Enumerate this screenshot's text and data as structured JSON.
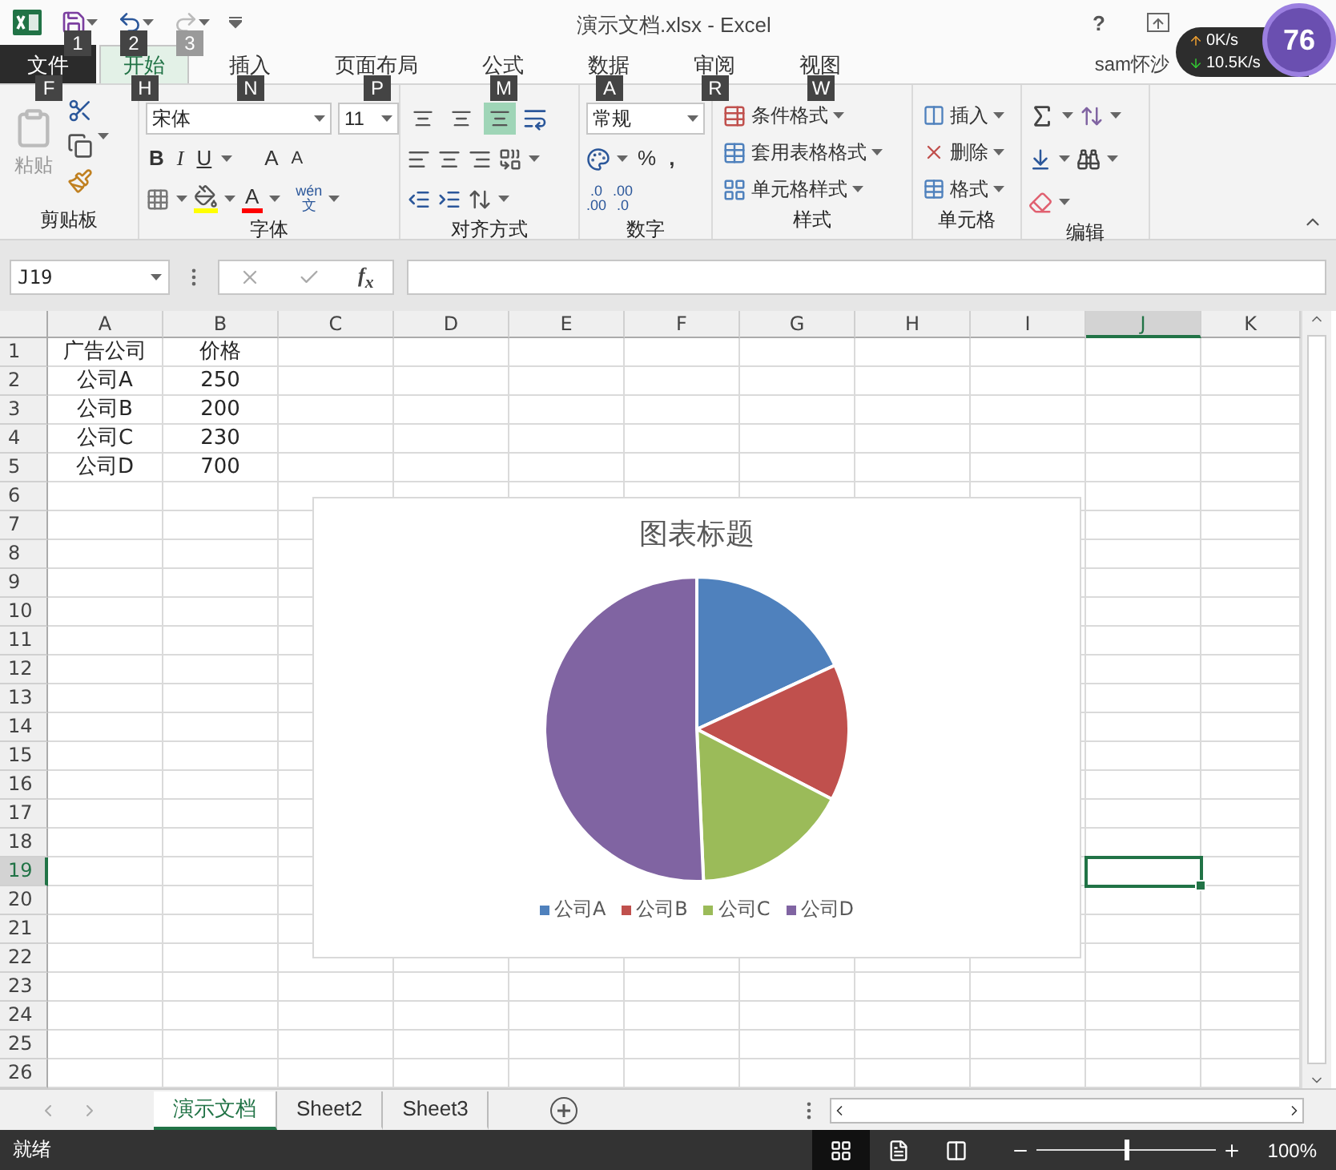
{
  "title_bar": {
    "quick_access": [
      {
        "key_tip": "1",
        "disabled": false
      },
      {
        "key_tip": "2",
        "disabled": false
      },
      {
        "key_tip": "3",
        "disabled": true
      }
    ],
    "title": "演示文档.xlsx - Excel",
    "help": "?",
    "user": "sam怀沙"
  },
  "net_widget": {
    "up": "0K/s",
    "down": "10.5K/s",
    "score": "76"
  },
  "tabs": [
    {
      "label": "文件",
      "key_tip": "F",
      "kind": "file",
      "selected": false
    },
    {
      "label": "开始",
      "key_tip": "H",
      "kind": "tab",
      "selected": true
    },
    {
      "label": "插入",
      "key_tip": "N",
      "kind": "tab",
      "selected": false
    },
    {
      "label": "页面布局",
      "key_tip": "P",
      "kind": "tab",
      "selected": false
    },
    {
      "label": "公式",
      "key_tip": "M",
      "kind": "tab",
      "selected": false
    },
    {
      "label": "数据",
      "key_tip": "A",
      "kind": "tab",
      "selected": false
    },
    {
      "label": "审阅",
      "key_tip": "R",
      "kind": "tab",
      "selected": false
    },
    {
      "label": "视图",
      "key_tip": "W",
      "kind": "tab",
      "selected": false
    }
  ],
  "ribbon": {
    "clipboard": {
      "label": "剪贴板",
      "paste": "粘贴"
    },
    "font": {
      "label": "字体",
      "font_name": "宋体",
      "font_size": "11",
      "bold": "B",
      "italic": "I",
      "underline": "U",
      "grow": "A",
      "shrink": "A",
      "font_color": "A",
      "phonetic_top": "wén",
      "phonetic_bottom": "文"
    },
    "alignment": {
      "label": "对齐方式",
      "vertical": [
        {
          "selected": false
        },
        {
          "selected": false
        },
        {
          "selected": true
        }
      ]
    },
    "number": {
      "label": "数字",
      "format": "常规",
      "percent": "%",
      "comma": ",",
      "increase_decimal": [
        ".0",
        ".00"
      ],
      "decrease_decimal": [
        ".00",
        ".0"
      ]
    },
    "styles": {
      "label": "样式",
      "buttons": [
        "条件格式",
        "套用表格格式",
        "单元格样式"
      ]
    },
    "cells": {
      "label": "单元格",
      "buttons": [
        "插入",
        "删除",
        "格式"
      ]
    },
    "editing": {
      "label": "编辑"
    }
  },
  "name_box": {
    "value": "J19"
  },
  "formula_bar": {
    "fx": "f$_{x}$"
  },
  "columns": [
    {
      "label": "A",
      "selected": false
    },
    {
      "label": "B",
      "selected": false
    },
    {
      "label": "C",
      "selected": false
    },
    {
      "label": "D",
      "selected": false
    },
    {
      "label": "E",
      "selected": false
    },
    {
      "label": "F",
      "selected": false
    },
    {
      "label": "G",
      "selected": false
    },
    {
      "label": "H",
      "selected": false
    },
    {
      "label": "I",
      "selected": false
    },
    {
      "label": "J",
      "selected": true
    },
    {
      "label": "K",
      "selected": false
    }
  ],
  "rows": [
    {
      "label": "1",
      "selected": false,
      "cells": [
        "广告公司",
        "价格"
      ]
    },
    {
      "label": "2",
      "selected": false,
      "cells": [
        "公司A",
        "250"
      ]
    },
    {
      "label": "3",
      "selected": false,
      "cells": [
        "公司B",
        "200"
      ]
    },
    {
      "label": "4",
      "selected": false,
      "cells": [
        "公司C",
        "230"
      ]
    },
    {
      "label": "5",
      "selected": false,
      "cells": [
        "公司D",
        "700"
      ]
    },
    {
      "label": "6",
      "selected": false,
      "cells": []
    },
    {
      "label": "7",
      "selected": false,
      "cells": []
    },
    {
      "label": "8",
      "selected": false,
      "cells": []
    },
    {
      "label": "9",
      "selected": false,
      "cells": []
    },
    {
      "label": "10",
      "selected": false,
      "cells": []
    },
    {
      "label": "11",
      "selected": false,
      "cells": []
    },
    {
      "label": "12",
      "selected": false,
      "cells": []
    },
    {
      "label": "13",
      "selected": false,
      "cells": []
    },
    {
      "label": "14",
      "selected": false,
      "cells": []
    },
    {
      "label": "15",
      "selected": false,
      "cells": []
    },
    {
      "label": "16",
      "selected": false,
      "cells": []
    },
    {
      "label": "17",
      "selected": false,
      "cells": []
    },
    {
      "label": "18",
      "selected": false,
      "cells": []
    },
    {
      "label": "19",
      "selected": true,
      "cells": []
    },
    {
      "label": "20",
      "selected": false,
      "cells": []
    },
    {
      "label": "21",
      "selected": false,
      "cells": []
    },
    {
      "label": "22",
      "selected": false,
      "cells": []
    },
    {
      "label": "23",
      "selected": false,
      "cells": []
    },
    {
      "label": "24",
      "selected": false,
      "cells": []
    },
    {
      "label": "25",
      "selected": false,
      "cells": []
    },
    {
      "label": "26",
      "selected": false,
      "cells": []
    }
  ],
  "chart": {
    "chart_data": {
      "type": "pie",
      "title": "图表标题",
      "categories": [
        "公司A",
        "公司B",
        "公司C",
        "公司D"
      ],
      "legend": "bottom",
      "series": [
        {
          "values": [
            18.1,
            14.5,
            16.7,
            50.7
          ]
        }
      ]
    },
    "slices": [
      {
        "color": "#4f81bd"
      },
      {
        "color": "#c0504d"
      },
      {
        "color": "#9bbb59"
      },
      {
        "color": "#8064a2"
      }
    ]
  },
  "sheet_tabs": [
    {
      "label": "演示文档",
      "selected": true
    },
    {
      "label": "Sheet2",
      "selected": false
    },
    {
      "label": "Sheet3",
      "selected": false
    }
  ],
  "status_bar": {
    "status": "就绪",
    "views": [
      {
        "selected": true
      },
      {
        "selected": false
      },
      {
        "selected": false
      }
    ],
    "zoom": {
      "level": 0.5
    },
    "zoom_text": "100%"
  }
}
